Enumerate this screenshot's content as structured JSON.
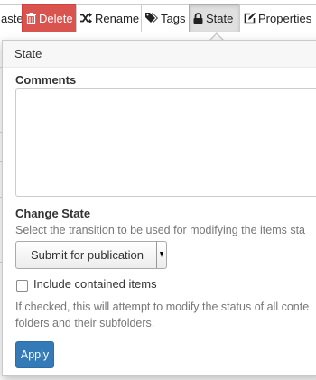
{
  "toolbar": {
    "paste_label": "aste",
    "delete_label": "Delete",
    "rename_label": "Rename",
    "tags_label": "Tags",
    "state_label": "State",
    "properties_label": "Properties"
  },
  "popover": {
    "title": "State",
    "comments_label": "Comments",
    "comments_value": "",
    "change_state_label": "Change State",
    "change_state_help": "Select the transition to be used for modifying the items sta",
    "transition_selected": "Submit for publication",
    "include_contained_label": "Include contained items",
    "include_contained_checked": false,
    "include_help_line1": "If checked, this will attempt to modify the status of all conte",
    "include_help_line2": "folders and their subfolders.",
    "apply_label": "Apply"
  },
  "icons": {
    "delete": "trash-icon",
    "rename": "shuffle-icon",
    "tags": "tags-icon",
    "state": "lock-icon",
    "properties": "edit-icon"
  },
  "colors": {
    "danger": "#d9534f",
    "primary": "#337ab7",
    "active_bg": "#e0e0e0"
  }
}
